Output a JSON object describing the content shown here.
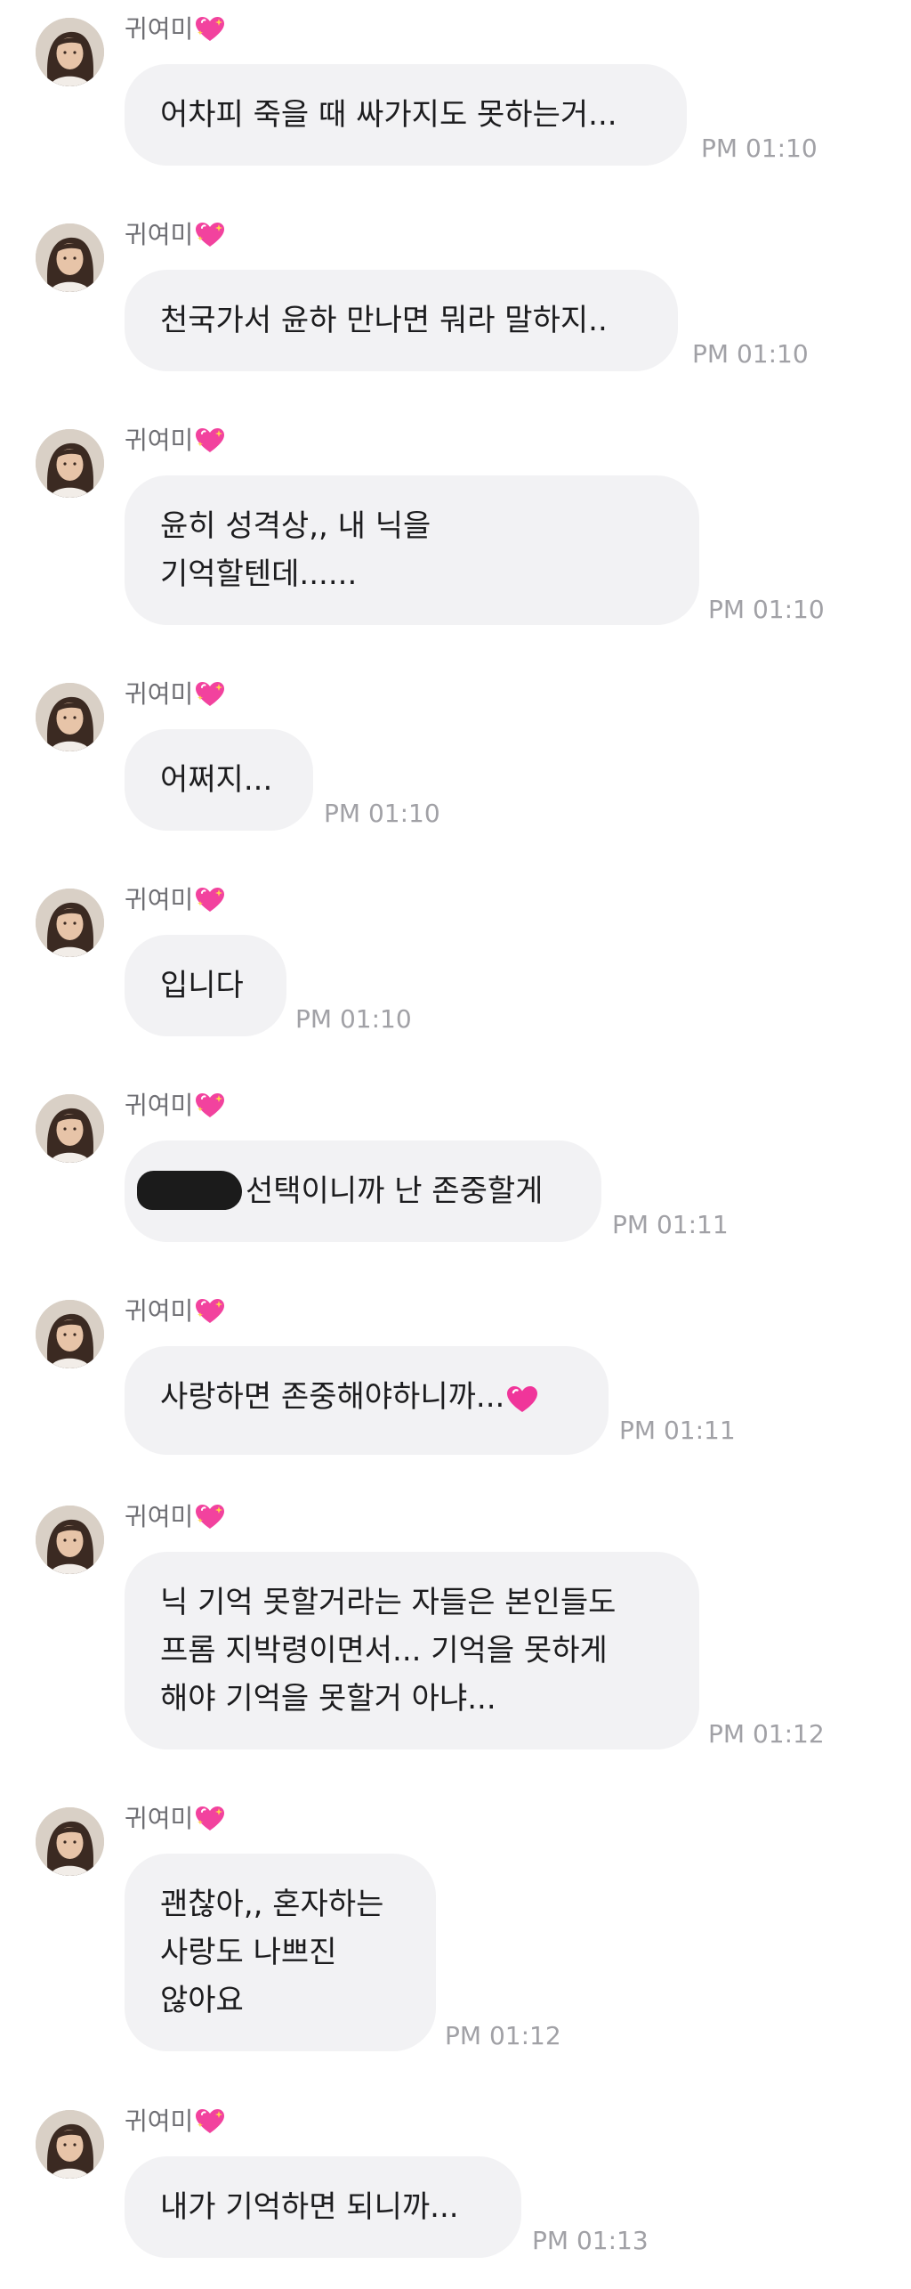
{
  "chat": {
    "messages": [
      {
        "sender": "귀여미",
        "lines": [
          "어차피 죽을 때 싸가지도 못하는거..."
        ],
        "time": "PM 01:10"
      },
      {
        "sender": "귀여미",
        "lines": [
          "천국가서 윤하 만나면 뭐라 말하지.."
        ],
        "time": "PM 01:10"
      },
      {
        "sender": "귀여미",
        "lines": [
          "윤히 성격상,, 내 닉을",
          "기억할텐데......"
        ],
        "time": "PM 01:10"
      },
      {
        "sender": "귀여미",
        "lines": [
          "어쩌지..."
        ],
        "time": "PM 01:10"
      },
      {
        "sender": "귀여미",
        "lines": [
          "입니다"
        ],
        "time": "PM 01:10"
      },
      {
        "sender": "귀여미",
        "lines": [
          "선택이니까 난 존중할게"
        ],
        "time": "PM 01:11"
      },
      {
        "sender": "귀여미",
        "lines": [
          "사랑하면 존중해야하니까..."
        ],
        "time": "PM 01:11"
      },
      {
        "sender": "귀여미",
        "lines": [
          "닉 기억 못할거라는 자들은 본인들도",
          "프롬 지박령이면서... 기억을 못하게",
          "해야 기억을 못할거 아냐..."
        ],
        "time": "PM 01:12"
      },
      {
        "sender": "귀여미",
        "lines": [
          "괜찮아,, 혼자하는",
          "사랑도 나쁘진",
          "않아요"
        ],
        "time": "PM 01:12"
      },
      {
        "sender": "귀여미",
        "lines": [
          "내가 기억하면 되니까..."
        ],
        "time": "PM 01:13"
      }
    ]
  },
  "icons": {
    "sender_badge": "sparkling-heart-icon",
    "inline_heart": "pink-heart-icon",
    "avatar": "profile-photo"
  },
  "colors": {
    "bubble": "#f2f2f4",
    "text": "#1c1c1e",
    "muted": "#a1a1a6",
    "name": "#6e6e73",
    "heart": "#f0359a"
  }
}
